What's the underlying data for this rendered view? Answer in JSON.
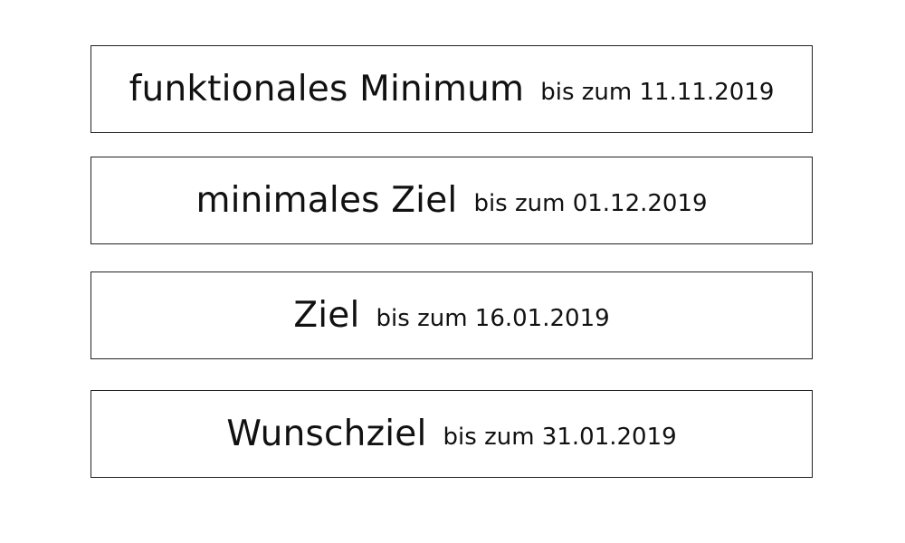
{
  "goals": [
    {
      "title": "funktionales Minimum",
      "deadline": "bis zum 11.11.2019"
    },
    {
      "title": "minimales Ziel",
      "deadline": "bis zum 01.12.2019"
    },
    {
      "title": "Ziel",
      "deadline": "bis zum 16.01.2019"
    },
    {
      "title": "Wunschziel",
      "deadline": "bis zum 31.01.2019"
    }
  ]
}
